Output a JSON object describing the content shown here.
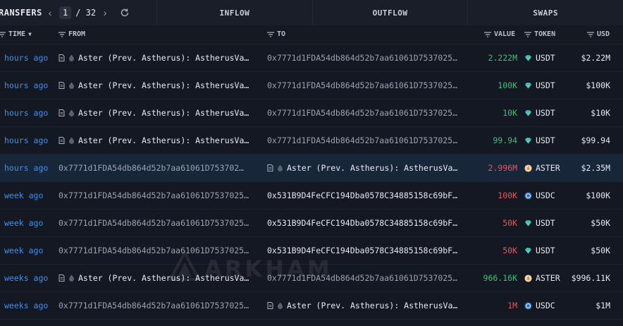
{
  "header": {
    "title": "RANSFERS",
    "page_current": "1",
    "page_total": "/ 32"
  },
  "tabs": [
    "INFLOW",
    "OUTFLOW",
    "SWAPS"
  ],
  "columns": {
    "time": "TIME",
    "from": "FROM",
    "to": "TO",
    "value": "VALUE",
    "token": "TOKEN",
    "usd": "USD"
  },
  "colors": {
    "accent": "#3f8ff0",
    "positive": "#3fc07a",
    "negative": "#e2585d",
    "highlight_row": "#18263a"
  },
  "rows": [
    {
      "time": "hours ago",
      "from": "Aster (Prev. Astherus): AstherusVa…",
      "to": "0x7771d1FDA54db864d52b7aa61061D7537025…",
      "value": "2.222M",
      "token": "USDT",
      "usd": "$2.22M"
    },
    {
      "time": "hours ago",
      "from": "Aster (Prev. Astherus): AstherusVa…",
      "to": "0x7771d1FDA54db864d52b7aa61061D7537025…",
      "value": "100K",
      "token": "USDT",
      "usd": "$100K"
    },
    {
      "time": "hours ago",
      "from": "Aster (Prev. Astherus): AstherusVa…",
      "to": "0x7771d1FDA54db864d52b7aa61061D7537025…",
      "value": "10K",
      "token": "USDT",
      "usd": "$10K"
    },
    {
      "time": "hours ago",
      "from": "Aster (Prev. Astherus): AstherusVa…",
      "to": "0x7771d1FDA54db864d52b7aa61061D7537025…",
      "value": "99.94",
      "token": "USDT",
      "usd": "$99.94"
    },
    {
      "time": "hours ago",
      "from": "0x7771d1FDA54db864d52b7aa61061D753702…",
      "to": "Aster (Prev. Astherus): AstherusVa…",
      "value": "2.996M",
      "token": "ASTER",
      "usd": "$2.35M"
    },
    {
      "time": "week ago",
      "from": "0x7771d1FDA54db864d52b7aa61061D7537025…",
      "to": "0x531B9D4FeCFC194Dba0578C34885158c69bF…",
      "value": "100K",
      "token": "USDC",
      "usd": "$100K"
    },
    {
      "time": "week ago",
      "from": "0x7771d1FDA54db864d52b7aa61061D7537025…",
      "to": "0x531B9D4FeCFC194Dba0578C34885158c69bF…",
      "value": "50K",
      "token": "USDT",
      "usd": "$50K"
    },
    {
      "time": "week ago",
      "from": "0x7771d1FDA54db864d52b7aa61061D7537025…",
      "to": "0x531B9D4FeCFC194Dba0578C34885158c69bF…",
      "value": "50K",
      "token": "USDT",
      "usd": "$50K"
    },
    {
      "time": "weeks ago",
      "from": "Aster (Prev. Astherus): AstherusVa…",
      "to": "0x7771d1FDA54db864d52b7aa61061D7537025…",
      "value": "966.16K",
      "token": "ASTER",
      "usd": "$996.11K"
    },
    {
      "time": "weeks ago",
      "from": "0x7771d1FDA54db864d52b7aa61061D7537025…",
      "to": "Aster (Prev. Astherus): AstherusVa…",
      "value": "1M",
      "token": "USDC",
      "usd": "$1M"
    }
  ],
  "watermark": "ARKHAM"
}
